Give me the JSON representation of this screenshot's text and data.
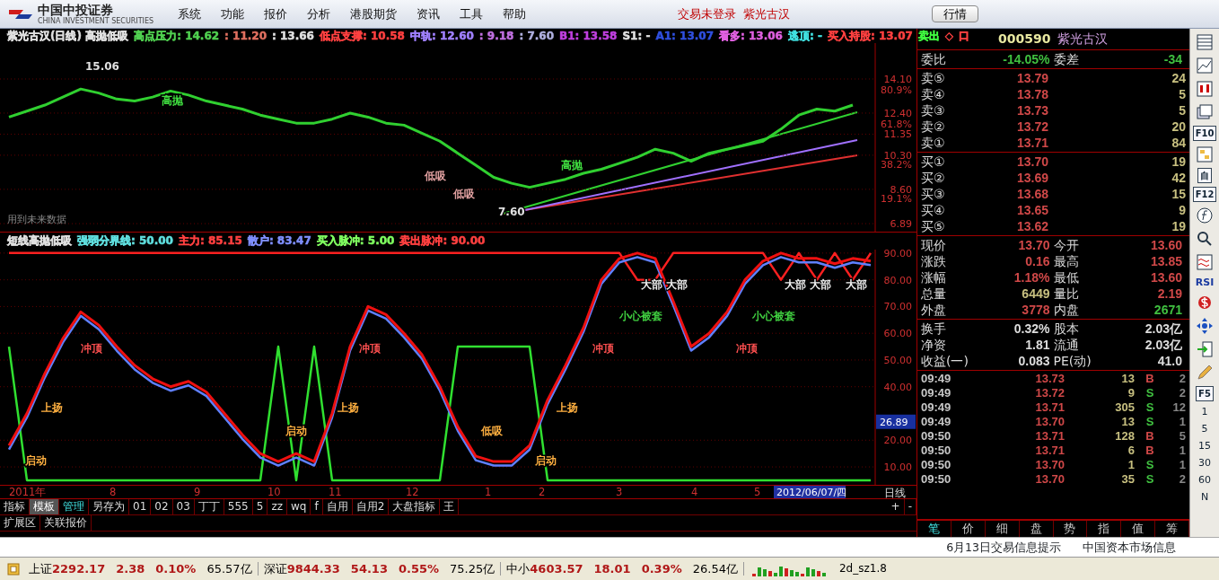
{
  "window": {
    "logo_text": "中国中投证券",
    "logo_subtext": "CHINA INVESTMENT SECURITIES"
  },
  "menu": [
    "系统",
    "功能",
    "报价",
    "分析",
    "港股期货",
    "资讯",
    "工具",
    "帮助"
  ],
  "trade_status": "交易未登录",
  "stock_title": "紫光古汉",
  "buttons": [
    "行情"
  ],
  "main_chart": {
    "header": [
      {
        "text": "紫光古汉(日线) 高抛低吸",
        "color": "#e0e0e0"
      },
      {
        "text": "高点压力: 14.62",
        "color": "#50d050"
      },
      {
        "text": ": 11.20",
        "color": "#e07060"
      },
      {
        "text": ": 13.66",
        "color": "#e0e0e0"
      },
      {
        "text": "低点支撑: 10.58",
        "color": "#ff4040"
      },
      {
        "text": "中轨: 12.60",
        "color": "#a080ff"
      },
      {
        "text": ": 9.18",
        "color": "#c070e0"
      },
      {
        "text": ": 7.60",
        "color": "#b0b0e0"
      },
      {
        "text": "B1: 13.58",
        "color": "#c040e0"
      },
      {
        "text": "S1: -",
        "color": "#e0e0e0"
      },
      {
        "text": "A1: 13.07",
        "color": "#3050e0"
      },
      {
        "text": "看多: 13.06",
        "color": "#e060e0"
      },
      {
        "text": "逃顶: -",
        "color": "#40e0e0"
      },
      {
        "text": "买入持股: 13.07",
        "color": "#ff4040"
      },
      {
        "text": "卖出",
        "color": "#40ff40"
      },
      {
        "text": "◇",
        "color": "#ff4040"
      },
      {
        "text": "口",
        "color": "#ff4040"
      }
    ],
    "note": "用到未来数据",
    "axis_labels": [
      "80.9%",
      "61.8%",
      "38.2%",
      "19.1%"
    ],
    "chart_data": {
      "type": "line",
      "grid": true,
      "ylim": [
        6.49,
        15.89
      ],
      "yticks": [
        {
          "value": 14.1,
          "label": "14.10"
        },
        {
          "value": 12.4,
          "label": "12.40"
        },
        {
          "value": 11.35,
          "label": "11.35"
        },
        {
          "value": 10.3,
          "label": "10.30"
        },
        {
          "value": 8.6,
          "label": "8.60"
        },
        {
          "value": 6.89,
          "label": "6.89"
        }
      ],
      "series": [
        {
          "color": "#30d030",
          "values": [
            12.2,
            12.5,
            12.8,
            13.2,
            13.6,
            13.4,
            13.1,
            13.0,
            13.2,
            13.5,
            13.3,
            13.0,
            12.8,
            12.6,
            12.3,
            12.1,
            11.9,
            11.9,
            12.1,
            12.4,
            12.2,
            11.9,
            11.8,
            11.4,
            11.0,
            10.4,
            9.8,
            9.2,
            8.9,
            8.7,
            8.9,
            9.1,
            9.4,
            9.6,
            9.9,
            10.2,
            10.6,
            10.4,
            10.0,
            10.4,
            10.6,
            10.8,
            11.0,
            11.6,
            12.3,
            12.6,
            12.5,
            12.8
          ]
        }
      ]
    },
    "marks": [
      {
        "text": "15.06",
        "color": "#e0e0e0"
      },
      {
        "text": "7.60",
        "color": "#e0e0e0"
      },
      {
        "text": "高抛",
        "color": "#40e040"
      },
      {
        "text": "高抛",
        "color": "#40e040"
      },
      {
        "text": "低吸",
        "color": "#e0a0a0"
      },
      {
        "text": "低吸",
        "color": "#e0a0a0"
      }
    ]
  },
  "indicator_chart": {
    "header": [
      {
        "text": "短线高抛低吸",
        "color": "#e0e0e0"
      },
      {
        "text": "强弱分界线: 50.00",
        "color": "#60e0e0"
      },
      {
        "text": "主力: 85.15",
        "color": "#ff4040"
      },
      {
        "text": "散户: 83.47",
        "color": "#8090ff"
      },
      {
        "text": "买入脉冲: 5.00",
        "color": "#80ff60"
      },
      {
        "text": "卖出脉冲: 90.00",
        "color": "#ff4040"
      }
    ],
    "chart_data": {
      "type": "line",
      "grid": true,
      "ylim": [
        3.3,
        91.3
      ],
      "yticks": [
        {
          "value": 90,
          "label": "90.00"
        },
        {
          "value": 80,
          "label": "80.00"
        },
        {
          "value": 70,
          "label": "70.00"
        },
        {
          "value": 60,
          "label": "60.00"
        },
        {
          "value": 50,
          "label": "50.00"
        },
        {
          "value": 40,
          "label": "40.00"
        },
        {
          "value": 20,
          "label": "20.00"
        },
        {
          "value": 10,
          "label": "10.00"
        }
      ],
      "series": [
        {
          "color": "#30e030",
          "values": [
            55,
            5,
            5,
            5,
            5,
            5,
            5,
            5,
            5,
            5,
            5,
            5,
            5,
            5,
            5,
            55,
            5,
            55,
            5,
            5,
            5,
            5,
            5,
            5,
            5,
            55,
            55,
            55,
            55,
            55,
            5,
            5,
            5,
            5,
            5,
            5,
            5,
            5,
            5,
            5,
            5,
            5,
            5,
            5,
            5,
            5,
            5,
            5,
            5
          ]
        },
        {
          "color": "#ff2020",
          "values": [
            90,
            90,
            90,
            90,
            90,
            90,
            90,
            90,
            90,
            90,
            90,
            90,
            90,
            90,
            90,
            90,
            90,
            90,
            90,
            90,
            90,
            90,
            90,
            90,
            90,
            90,
            90,
            90,
            90,
            90,
            90,
            90,
            90,
            90,
            90,
            80,
            80,
            90,
            90,
            90,
            90,
            90,
            90,
            80,
            90,
            80,
            90,
            80,
            90
          ]
        },
        {
          "color": "#6080ff",
          "values": [
            16.5,
            28.5,
            43.5,
            56.5,
            66.5,
            61.5,
            53.5,
            46.5,
            41.5,
            38.5,
            40.5,
            36.5,
            28.5,
            20.5,
            13.5,
            10.5,
            13.5,
            10.5,
            28.5,
            53.5,
            68.5,
            65.5,
            58.5,
            50.5,
            38.5,
            23.5,
            12.5,
            10.5,
            10.5,
            16.5,
            33.5,
            46.5,
            60.5,
            78.5,
            86.5,
            88.5,
            86.5,
            70.5,
            53.5,
            58.5,
            66.5,
            78.5,
            85.5,
            88.5,
            86.5,
            86.5,
            84.5,
            86.5,
            85.5
          ]
        },
        {
          "color": "#ee1010",
          "values": [
            18,
            30,
            45,
            58,
            68,
            63,
            55,
            48,
            43,
            40,
            42,
            38,
            30,
            22,
            15,
            12,
            15,
            12,
            30,
            55,
            70,
            67,
            60,
            52,
            40,
            25,
            14,
            12,
            12,
            18,
            35,
            48,
            62,
            80,
            88,
            90,
            88,
            72,
            55,
            60,
            68,
            80,
            87,
            90,
            88,
            88,
            86,
            88,
            87
          ]
        }
      ]
    },
    "current_value": "26.89",
    "marks": [
      {
        "text": "冲顶",
        "color": "#ff5050"
      },
      {
        "text": "冲顶",
        "color": "#ff5050"
      },
      {
        "text": "冲顶",
        "color": "#ff5050"
      },
      {
        "text": "冲顶",
        "color": "#ff5050"
      },
      {
        "text": "上扬",
        "color": "#ffb040"
      },
      {
        "text": "上扬",
        "color": "#ffb040"
      },
      {
        "text": "上扬",
        "color": "#ffb040"
      },
      {
        "text": "启动",
        "color": "#ffb040"
      },
      {
        "text": "启动",
        "color": "#ffb040"
      },
      {
        "text": "低吸",
        "color": "#ffb040"
      },
      {
        "text": "启动",
        "color": "#ffb040"
      },
      {
        "text": "小心被套",
        "color": "#40d040"
      },
      {
        "text": "小心被套",
        "color": "#40d040"
      },
      {
        "text": "大部",
        "color": "#f0f0f0"
      },
      {
        "text": "大部",
        "color": "#f0f0f0"
      },
      {
        "text": "大部",
        "color": "#f0f0f0"
      },
      {
        "text": "大部",
        "color": "#f0f0f0"
      },
      {
        "text": "大部",
        "color": "#f0f0f0"
      }
    ]
  },
  "date_axis": {
    "labels": [
      "2011年",
      "8",
      "9",
      "10",
      "11",
      "12",
      "1",
      "2",
      "3",
      "4",
      "5"
    ],
    "cursor_date": "2012/06/07/四",
    "period": "日线"
  },
  "indicator_tabs": [
    {
      "label": "指标",
      "selected": false,
      "highlighted": false
    },
    {
      "label": "模板",
      "selected": true,
      "highlighted": false
    },
    {
      "label": "管理",
      "selected": false,
      "highlighted": true
    },
    {
      "label": "另存为",
      "selected": false,
      "highlighted": false
    },
    {
      "label": "01",
      "selected": false,
      "highlighted": false
    },
    {
      "label": "02",
      "selected": false,
      "highlighted": false
    },
    {
      "label": "03",
      "selected": false,
      "highlighted": false
    },
    {
      "label": "丁丁",
      "selected": false,
      "highlighted": false
    },
    {
      "label": "555",
      "selected": false,
      "highlighted": false
    },
    {
      "label": "5",
      "selected": false,
      "highlighted": false
    },
    {
      "label": "zz",
      "selected": false,
      "highlighted": false
    },
    {
      "label": "wq",
      "selected": false,
      "highlighted": false
    },
    {
      "label": "f",
      "selected": false,
      "highlighted": false
    },
    {
      "label": "自用",
      "selected": false,
      "highlighted": false
    },
    {
      "label": "自用2",
      "selected": false,
      "highlighted": false
    },
    {
      "label": "大盘指标",
      "selected": false,
      "highlighted": false
    },
    {
      "label": "王",
      "selected": false,
      "highlighted": false
    }
  ],
  "zoom_buttons": [
    "+",
    "-"
  ],
  "extension_tabs": [
    "扩展区",
    "关联报价"
  ],
  "quote_panel": {
    "code": "000590",
    "name": "紫光古汉",
    "ratio": [
      {
        "label": "委比",
        "value": "-14.05%",
        "kind": "down"
      },
      {
        "label": "委差",
        "value": "-34",
        "kind": "down"
      }
    ],
    "asks": [
      {
        "label": "卖⑤",
        "price": "13.79",
        "volume": "24"
      },
      {
        "label": "卖④",
        "price": "13.78",
        "volume": "5"
      },
      {
        "label": "卖③",
        "price": "13.73",
        "volume": "5"
      },
      {
        "label": "卖②",
        "price": "13.72",
        "volume": "20"
      },
      {
        "label": "卖①",
        "price": "13.71",
        "volume": "84"
      }
    ],
    "bids": [
      {
        "label": "买①",
        "price": "13.70",
        "volume": "19"
      },
      {
        "label": "买②",
        "price": "13.69",
        "volume": "42"
      },
      {
        "label": "买③",
        "price": "13.68",
        "volume": "15"
      },
      {
        "label": "买④",
        "price": "13.65",
        "volume": "9"
      },
      {
        "label": "买⑤",
        "price": "13.62",
        "volume": "19"
      }
    ],
    "stats": [
      {
        "label": "现价",
        "value": "13.70",
        "kind": "up"
      },
      {
        "label": "今开",
        "value": "13.60",
        "kind": "up"
      },
      {
        "label": "涨跌",
        "value": "0.16",
        "kind": "up"
      },
      {
        "label": "最高",
        "value": "13.85",
        "kind": "up"
      },
      {
        "label": "涨幅",
        "value": "1.18%",
        "kind": "up"
      },
      {
        "label": "最低",
        "value": "13.60",
        "kind": "up"
      },
      {
        "label": "总量",
        "value": "6449",
        "kind": "volume"
      },
      {
        "label": "量比",
        "value": "2.19",
        "kind": "up"
      },
      {
        "label": "外盘",
        "value": "3778",
        "kind": "up"
      },
      {
        "label": "内盘",
        "value": "2671",
        "kind": "down"
      }
    ],
    "fundamentals": [
      {
        "label": "换手",
        "value": "0.32%"
      },
      {
        "label": "股本",
        "value": "2.03亿"
      },
      {
        "label": "净资",
        "value": "1.81"
      },
      {
        "label": "流通",
        "value": "2.03亿"
      },
      {
        "label": "收益(一)",
        "value": "0.083"
      },
      {
        "label": "PE(动)",
        "value": "41.0"
      }
    ],
    "ticks": [
      {
        "time": "09:49",
        "price": "13.73",
        "volume": "13",
        "side": "B",
        "kind": "buy",
        "count": "2"
      },
      {
        "time": "09:49",
        "price": "13.72",
        "volume": "9",
        "side": "S",
        "kind": "sell",
        "count": "2"
      },
      {
        "time": "09:49",
        "price": "13.71",
        "volume": "305",
        "side": "S",
        "kind": "sell",
        "count": "12"
      },
      {
        "time": "09:49",
        "price": "13.70",
        "volume": "13",
        "side": "S",
        "kind": "sell",
        "count": "1"
      },
      {
        "time": "09:50",
        "price": "13.71",
        "volume": "128",
        "side": "B",
        "kind": "buy",
        "count": "5"
      },
      {
        "time": "09:50",
        "price": "13.71",
        "volume": "6",
        "side": "B",
        "kind": "buy",
        "count": "1"
      },
      {
        "time": "09:50",
        "price": "13.70",
        "volume": "1",
        "side": "S",
        "kind": "sell",
        "count": "1"
      },
      {
        "time": "09:50",
        "price": "13.70",
        "volume": "35",
        "side": "S",
        "kind": "sell",
        "count": "2"
      }
    ],
    "tabs": [
      {
        "label": "笔",
        "selected": true
      },
      {
        "label": "价",
        "selected": false
      },
      {
        "label": "细",
        "selected": false
      },
      {
        "label": "盘",
        "selected": false
      },
      {
        "label": "势",
        "selected": false
      },
      {
        "label": "指",
        "selected": false
      },
      {
        "label": "值",
        "selected": false
      },
      {
        "label": "筹",
        "selected": false
      }
    ]
  },
  "side_toolbar": {
    "labels": [
      "F10",
      "自",
      "F12",
      "RSI"
    ],
    "period_buttons": [
      "F5",
      "1",
      "5",
      "15",
      "30",
      "60",
      "N"
    ]
  },
  "info_links": [
    "6月13日交易信息提示",
    "中国资本市场信息"
  ],
  "market_bar": [
    {
      "name": "上证",
      "index": "2292.17",
      "change": "2.38",
      "percent": "0.10%",
      "amount": "65.57亿"
    },
    {
      "name": "深证",
      "index": "9844.33",
      "change": "54.13",
      "percent": "0.55%",
      "amount": "75.25亿"
    },
    {
      "name": "中小",
      "index": "4603.57",
      "change": "18.01",
      "percent": "0.39%",
      "amount": "26.54亿"
    }
  ],
  "ticker": "2d_sz1.8"
}
